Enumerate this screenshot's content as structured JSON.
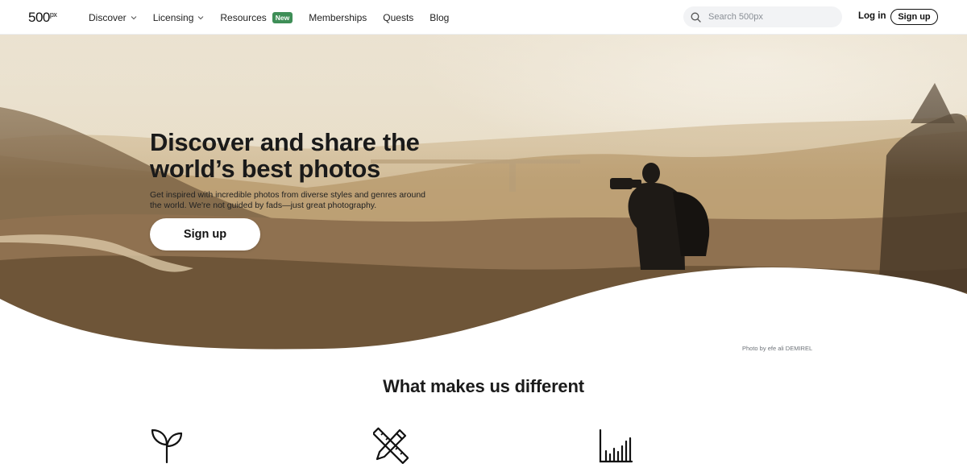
{
  "header": {
    "logo": "500",
    "logo_sup": "px",
    "nav": [
      {
        "label": "Discover",
        "has_dropdown": true
      },
      {
        "label": "Licensing",
        "has_dropdown": true
      },
      {
        "label": "Resources",
        "badge": "New"
      },
      {
        "label": "Memberships"
      },
      {
        "label": "Quests"
      },
      {
        "label": "Blog"
      }
    ],
    "search_placeholder": "Search 500px",
    "login_label": "Log in",
    "signup_label": "Sign up"
  },
  "hero": {
    "title_line1": "Discover and share the",
    "title_line2": "world’s best photos",
    "subtitle_line1": "Get inspired with incredible photos from diverse styles and genres around",
    "subtitle_line2": "the world. We're not guided by fads—just great photography.",
    "cta_label": "Sign up",
    "photo_credit": "Photo by efe ali DEMIREL"
  },
  "features": {
    "title": "What makes us different",
    "icons": [
      "sprout-icon",
      "pencil-ruler-icon",
      "bar-chart-icon"
    ]
  },
  "colors": {
    "badge": "#3e8e57",
    "hero_sky": "#f3ede0",
    "hero_hills": "#a8875c"
  }
}
